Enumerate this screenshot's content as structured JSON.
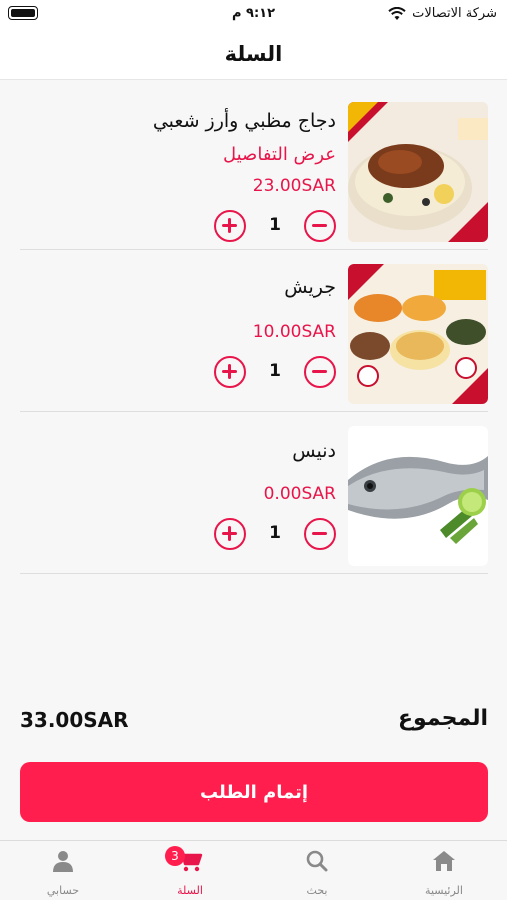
{
  "status_bar": {
    "carrier": "شركة الاتصالات",
    "time": "٩:١٢ م"
  },
  "header": {
    "title": "السلة"
  },
  "items": [
    {
      "name": "دجاج مظبي وأرز شعبي",
      "details_link": "عرض التفاصيل",
      "price": "23.00SAR",
      "quantity": "1"
    },
    {
      "name": "جريش",
      "price": "10.00SAR",
      "quantity": "1"
    },
    {
      "name": "دنيس",
      "price": "0.00SAR",
      "quantity": "1"
    }
  ],
  "summary": {
    "total_label": "المجموع",
    "total_value": "33.00SAR"
  },
  "checkout": {
    "label": "إتمام الطلب"
  },
  "tabs": [
    {
      "label": "الرئيسية",
      "icon": "home-icon"
    },
    {
      "label": "بحث",
      "icon": "search-icon"
    },
    {
      "label": "السلة",
      "icon": "cart-icon",
      "badge": "3"
    },
    {
      "label": "حسابي",
      "icon": "user-icon"
    }
  ],
  "colors": {
    "accent": "#ff1e4d",
    "price": "#e8154a"
  }
}
